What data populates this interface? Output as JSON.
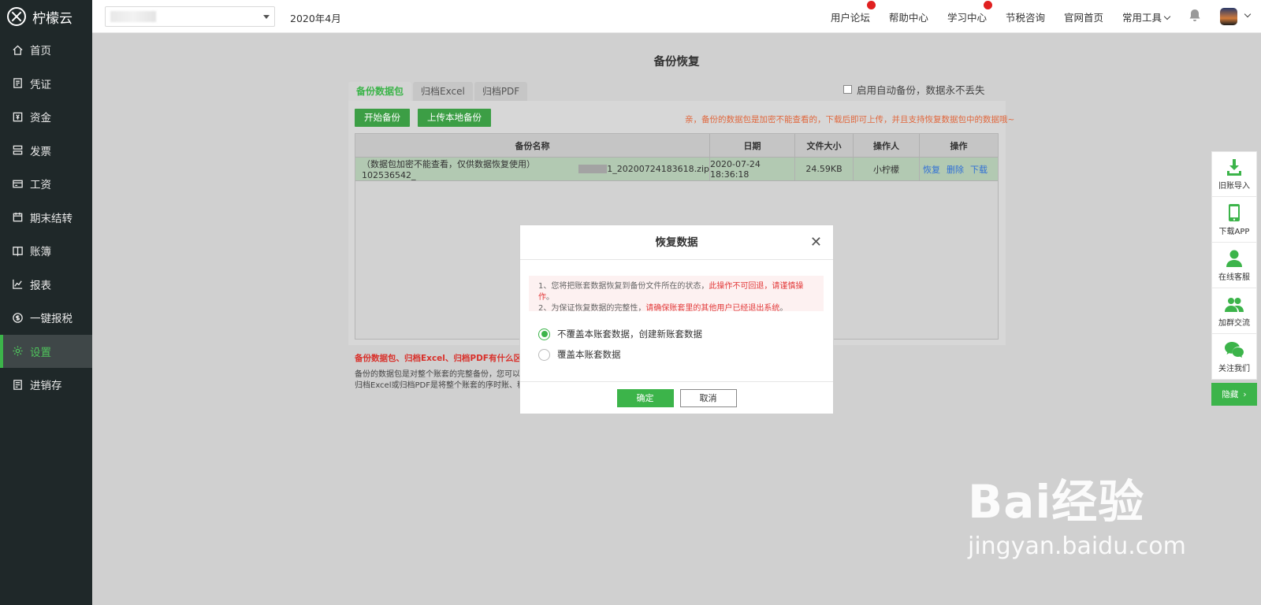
{
  "app": {
    "name": "柠檬云"
  },
  "sidebar": {
    "items": [
      {
        "label": "首页",
        "icon": "home-icon"
      },
      {
        "label": "凭证",
        "icon": "voucher-icon"
      },
      {
        "label": "资金",
        "icon": "funds-icon"
      },
      {
        "label": "发票",
        "icon": "invoice-icon"
      },
      {
        "label": "工资",
        "icon": "salary-icon"
      },
      {
        "label": "期末结转",
        "icon": "calendar-icon"
      },
      {
        "label": "账簿",
        "icon": "ledger-icon"
      },
      {
        "label": "报表",
        "icon": "report-chart-icon"
      },
      {
        "label": "一键报税",
        "icon": "tax-icon"
      },
      {
        "label": "设置",
        "icon": "gear-icon",
        "active": true
      },
      {
        "label": "进销存",
        "icon": "inventory-icon"
      }
    ],
    "active_color": "#3cb44a"
  },
  "topbar": {
    "period": "2020年4月",
    "links": [
      "用户论坛",
      "帮助中心",
      "学习中心",
      "节税咨询",
      "官网首页",
      "常用工具"
    ]
  },
  "page": {
    "title": "备份恢复",
    "tabs": [
      "备份数据包",
      "归档Excel",
      "归档PDF"
    ],
    "auto_backup_label": "启用自动备份，数据永不丢失",
    "start_backup_label": "开始备份",
    "upload_local_label": "上传本地备份",
    "notice": "亲，备份的数据包是加密不能查看的，下载后即可上传，并且支持恢复数据包中的数据哦~",
    "table": {
      "headers": [
        "备份名称",
        "日期",
        "文件大小",
        "操作人",
        "操作"
      ],
      "rows": [
        {
          "name_prefix": "（数据包加密不能查看，仅供数据恢复使用）102536542_",
          "name_suffix": "1_20200724183618.zip",
          "date": "2020-07-24 18:36:18",
          "size": "24.59KB",
          "operator": "小柠檬",
          "actions": [
            "恢复",
            "删除",
            "下载"
          ]
        }
      ]
    },
    "help_title": "备份数据包、归档Excel、归档PDF有什么区别?",
    "help_line1": "备份的数据包是对整个账套的完整备份，您可以",
    "help_line2": "归档Excel或归档PDF是将整个账套的序时账、科"
  },
  "side_tools": {
    "items": [
      {
        "label": "旧账导入",
        "icon": "download-icon"
      },
      {
        "label": "下载APP",
        "icon": "phone-icon"
      },
      {
        "label": "在线客服",
        "icon": "person-icon"
      },
      {
        "label": "加群交流",
        "icon": "group-icon"
      },
      {
        "label": "关注我们",
        "icon": "wechat-icon"
      }
    ],
    "hide_label": "隐藏"
  },
  "modal": {
    "title": "恢复数据",
    "warn_line1_a": "1、您将把账套数据恢复到备份文件所在的状态，",
    "warn_line1_b": "此操作不可回退，请谨慎操作",
    "warn_line1_c": "。",
    "warn_line2_a": "2、为保证恢复数据的完整性，",
    "warn_line2_b": "请确保账套里的其他用户已经退出系统",
    "warn_line2_c": "。",
    "option1": "不覆盖本账套数据，创建新账套数据",
    "option2": "覆盖本账套数据",
    "selected_option": 1,
    "ok_label": "确定",
    "cancel_label": "取消"
  },
  "watermark": {
    "line1": "Bai经验",
    "line2": "jingyan.baidu.com"
  }
}
